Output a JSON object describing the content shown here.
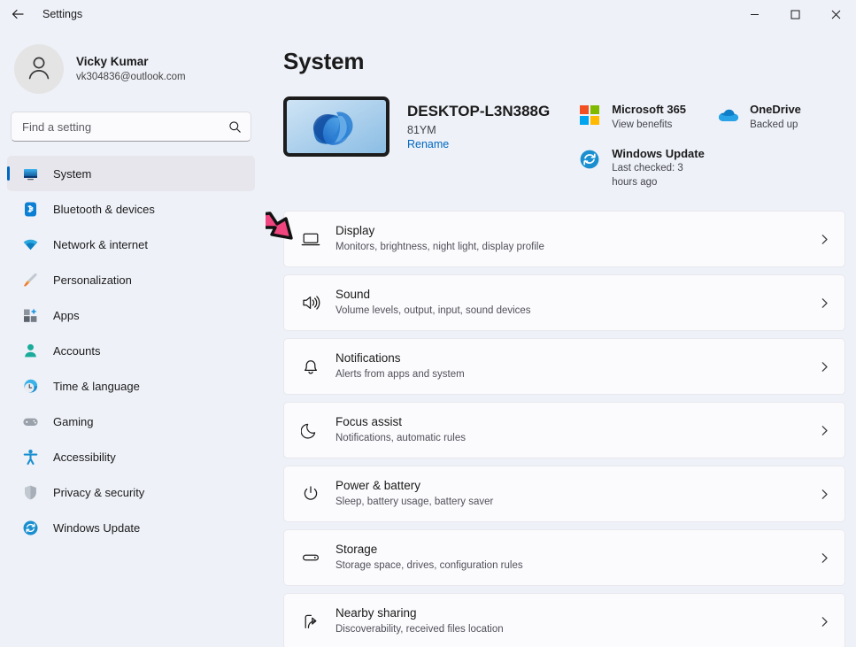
{
  "titlebar": {
    "back_icon": "back-arrow-icon",
    "title": "Settings",
    "minimize_label": "Minimize",
    "maximize_label": "Maximize",
    "close_label": "Close"
  },
  "sidebar": {
    "account": {
      "avatar_icon": "person-avatar-icon",
      "name": "Vicky Kumar",
      "email": "vk304836@outlook.com"
    },
    "search": {
      "placeholder": "Find a setting",
      "value": "",
      "icon": "search-icon"
    },
    "items": [
      {
        "label": "System",
        "icon": "system-monitor-icon",
        "active": true
      },
      {
        "label": "Bluetooth & devices",
        "icon": "bluetooth-icon",
        "active": false
      },
      {
        "label": "Network & internet",
        "icon": "wifi-icon",
        "active": false
      },
      {
        "label": "Personalization",
        "icon": "paintbrush-icon",
        "active": false
      },
      {
        "label": "Apps",
        "icon": "apps-grid-icon",
        "active": false
      },
      {
        "label": "Accounts",
        "icon": "account-person-icon",
        "active": false
      },
      {
        "label": "Time & language",
        "icon": "clock-globe-icon",
        "active": false
      },
      {
        "label": "Gaming",
        "icon": "gamepad-icon",
        "active": false
      },
      {
        "label": "Accessibility",
        "icon": "accessibility-person-icon",
        "active": false
      },
      {
        "label": "Privacy & security",
        "icon": "shield-icon",
        "active": false
      },
      {
        "label": "Windows Update",
        "icon": "windows-update-icon",
        "active": false
      }
    ]
  },
  "main": {
    "page_title": "System",
    "device": {
      "thumbnail_icon": "windows-bloom-wallpaper",
      "name": "DESKTOP-L3N388G",
      "model": "81YM",
      "rename_label": "Rename"
    },
    "status_cards": [
      {
        "title": "Microsoft 365",
        "subtitle": "View benefits",
        "icon": "microsoft-logo-icon"
      },
      {
        "title": "OneDrive",
        "subtitle": "Backed up",
        "icon": "onedrive-cloud-icon"
      },
      {
        "title": "Windows Update",
        "subtitle": "Last checked: 3 hours ago",
        "icon": "windows-update-icon"
      }
    ],
    "rows": [
      {
        "title": "Display",
        "subtitle": "Monitors, brightness, night light, display profile",
        "icon": "display-monitor-icon",
        "chevron": "chevron-right-icon"
      },
      {
        "title": "Sound",
        "subtitle": "Volume levels, output, input, sound devices",
        "icon": "speaker-icon",
        "chevron": "chevron-right-icon"
      },
      {
        "title": "Notifications",
        "subtitle": "Alerts from apps and system",
        "icon": "bell-icon",
        "chevron": "chevron-right-icon"
      },
      {
        "title": "Focus assist",
        "subtitle": "Notifications, automatic rules",
        "icon": "moon-icon",
        "chevron": "chevron-right-icon"
      },
      {
        "title": "Power & battery",
        "subtitle": "Sleep, battery usage, battery saver",
        "icon": "power-icon",
        "chevron": "chevron-right-icon"
      },
      {
        "title": "Storage",
        "subtitle": "Storage space, drives, configuration rules",
        "icon": "storage-drive-icon",
        "chevron": "chevron-right-icon"
      },
      {
        "title": "Nearby sharing",
        "subtitle": "Discoverability, received files location",
        "icon": "nearby-share-icon",
        "chevron": "chevron-right-icon"
      }
    ]
  },
  "annotation": {
    "arrow_icon": "pointer-arrow-annotation",
    "arrow_color": "#f0457e",
    "arrow_outline_color": "#111111",
    "points_at": "Display"
  },
  "colors": {
    "page_background": "#eef1f8",
    "card_background": "#fbfbfd",
    "accent": "#0067c0",
    "selected_item": "#e6e6ec",
    "link": "#0067c0"
  }
}
